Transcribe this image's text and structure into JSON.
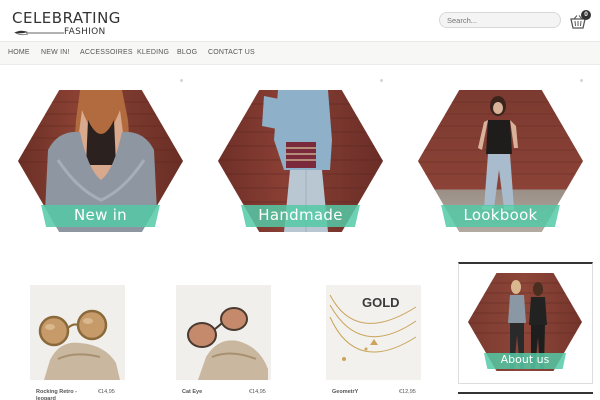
{
  "header": {
    "logo_top": "CELEBRATING",
    "logo_bottom": "FASHION",
    "search_placeholder": "Search...",
    "cart_count": "0"
  },
  "nav": {
    "items": [
      {
        "label": "HOME"
      },
      {
        "label": "NEW IN!"
      },
      {
        "label": "ACCESSOIRES"
      },
      {
        "label": "KLEDING"
      },
      {
        "label": "BLOG"
      },
      {
        "label": "CONTACT US"
      }
    ]
  },
  "tiles": [
    {
      "label": "New in"
    },
    {
      "label": "Handmade"
    },
    {
      "label": "Lookbook"
    }
  ],
  "products": [
    {
      "name": "Rocking Retro -\nleopard",
      "price": "€14,95"
    },
    {
      "name": "Cat Eye",
      "price": "€14,95"
    },
    {
      "name": "GeometrY",
      "price": "€12,95"
    }
  ],
  "about": {
    "label": "About us"
  },
  "colors": {
    "accent": "#53c9a6",
    "brick": "#7a3b30"
  }
}
